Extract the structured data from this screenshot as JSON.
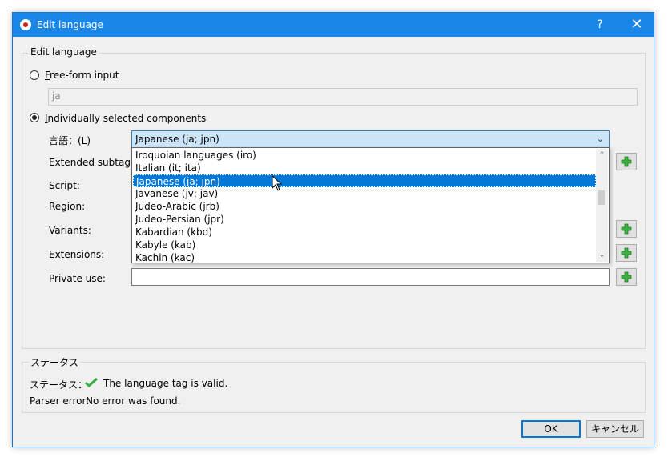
{
  "window": {
    "title": "Edit language",
    "help_label": "?",
    "close_label": "✕"
  },
  "edit_group": {
    "title": "Edit language",
    "free_form_label": "Free-form input",
    "free_form_value": "ja",
    "individual_label": "Individually selected components",
    "language_label": "言語：(L)",
    "language_value": "Japanese (ja; jpn)",
    "extended_label": "Extended subtags:",
    "script_label": "Script:",
    "region_label": "Region:",
    "variants_label": "Variants:",
    "extensions_label": "Extensions:",
    "private_label": "Private use:",
    "dropdown_items": [
      "Iroquoian languages (iro)",
      "Italian (it; ita)",
      "Japanese (ja; jpn)",
      "Javanese (jv; jav)",
      "Judeo-Arabic (jrb)",
      "Judeo-Persian (jpr)",
      "Kabardian (kbd)",
      "Kabyle (kab)",
      "Kachin (kac)"
    ],
    "selected_index": 2
  },
  "status_group": {
    "title": "ステータス",
    "status_label": "ステータス：",
    "status_text": "The language tag is valid.",
    "parser_label": "Parser error:",
    "parser_text": "No error was found."
  },
  "buttons": {
    "ok": "OK",
    "cancel": "キャンセル"
  },
  "colors": {
    "titlebar": "#1a86e8",
    "selection": "#0078d7",
    "combo_bg": "#cce4f7",
    "check_green": "#3cb043"
  }
}
